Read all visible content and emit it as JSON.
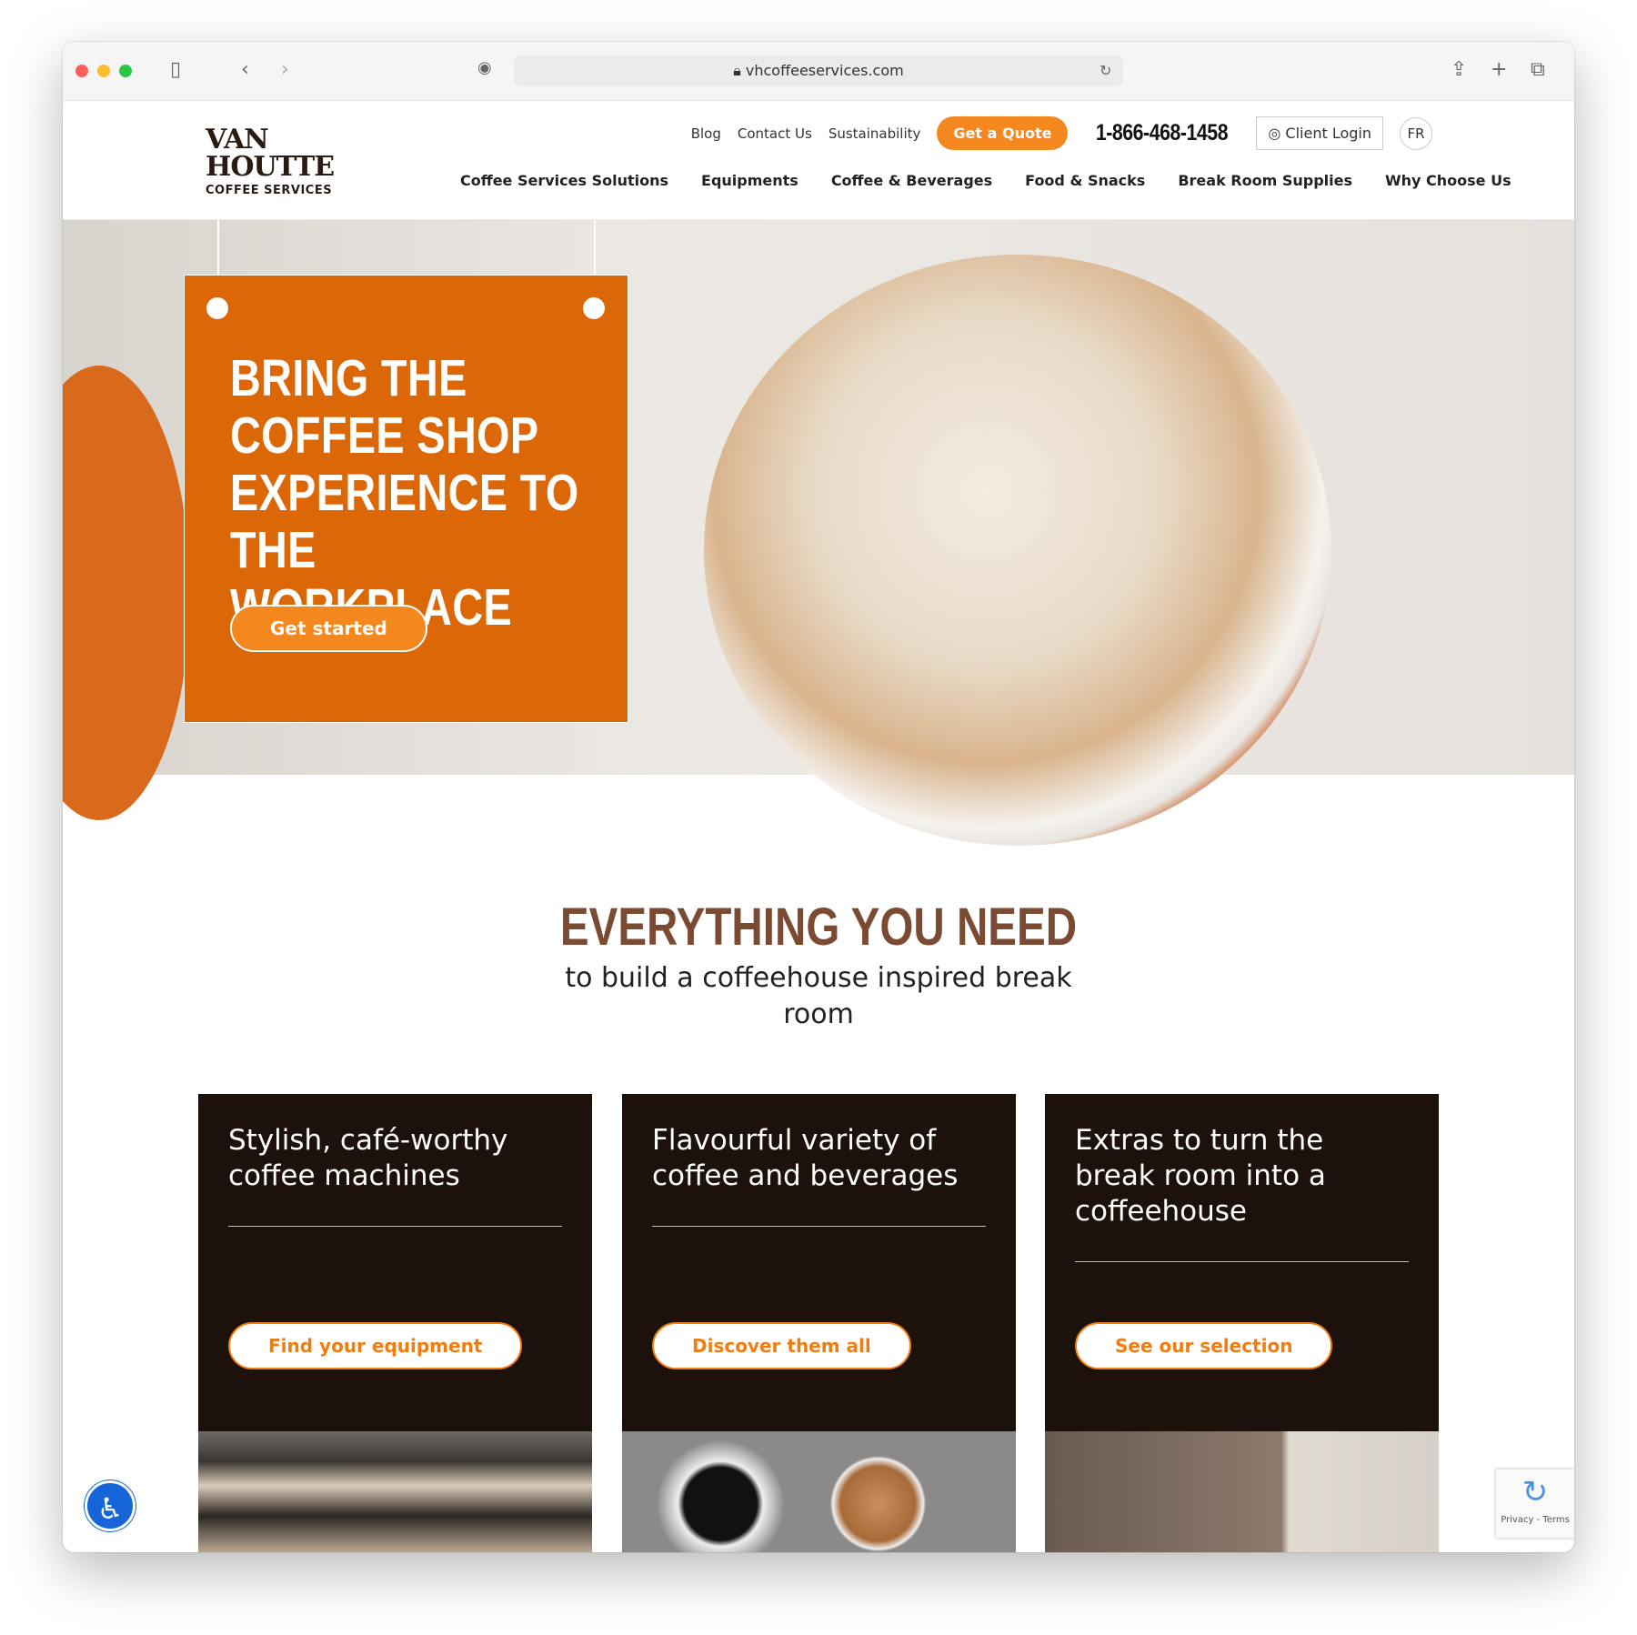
{
  "browser": {
    "url": "vhcoffeeservices.com"
  },
  "header": {
    "logo": {
      "line1": "VAN",
      "line2": "HOUTTE",
      "line3": "COFFEE SERVICES"
    },
    "util": {
      "blog": "Blog",
      "contact": "Contact Us",
      "sustainability": "Sustainability",
      "quote": "Get a Quote",
      "phone": "1-866-468-1458",
      "login": "Client Login",
      "lang": "FR"
    },
    "nav": [
      "Coffee Services Solutions",
      "Equipments",
      "Coffee & Beverages",
      "Food & Snacks",
      "Break Room Supplies",
      "Why Choose Us"
    ]
  },
  "hero": {
    "title": "BRING THE COFFEE SHOP EXPERIENCE TO THE WORKPLACE",
    "cta": "Get started"
  },
  "section": {
    "title": "EVERYTHING YOU NEED",
    "subtitle": "to build a coffeehouse inspired break room"
  },
  "cards": [
    {
      "title": "Stylish, café-worthy coffee machines",
      "cta": "Find your equipment"
    },
    {
      "title": "Flavourful variety of coffee and beverages",
      "cta": "Discover them all"
    },
    {
      "title": "Extras to turn the break room into a coffeehouse",
      "cta": "See our selection"
    }
  ],
  "recaptcha": {
    "text": "Privacy - Terms"
  },
  "colors": {
    "orange": "#dc6707",
    "accent": "#f5871f",
    "dark": "#1c120b",
    "brown": "#7b4a33"
  }
}
